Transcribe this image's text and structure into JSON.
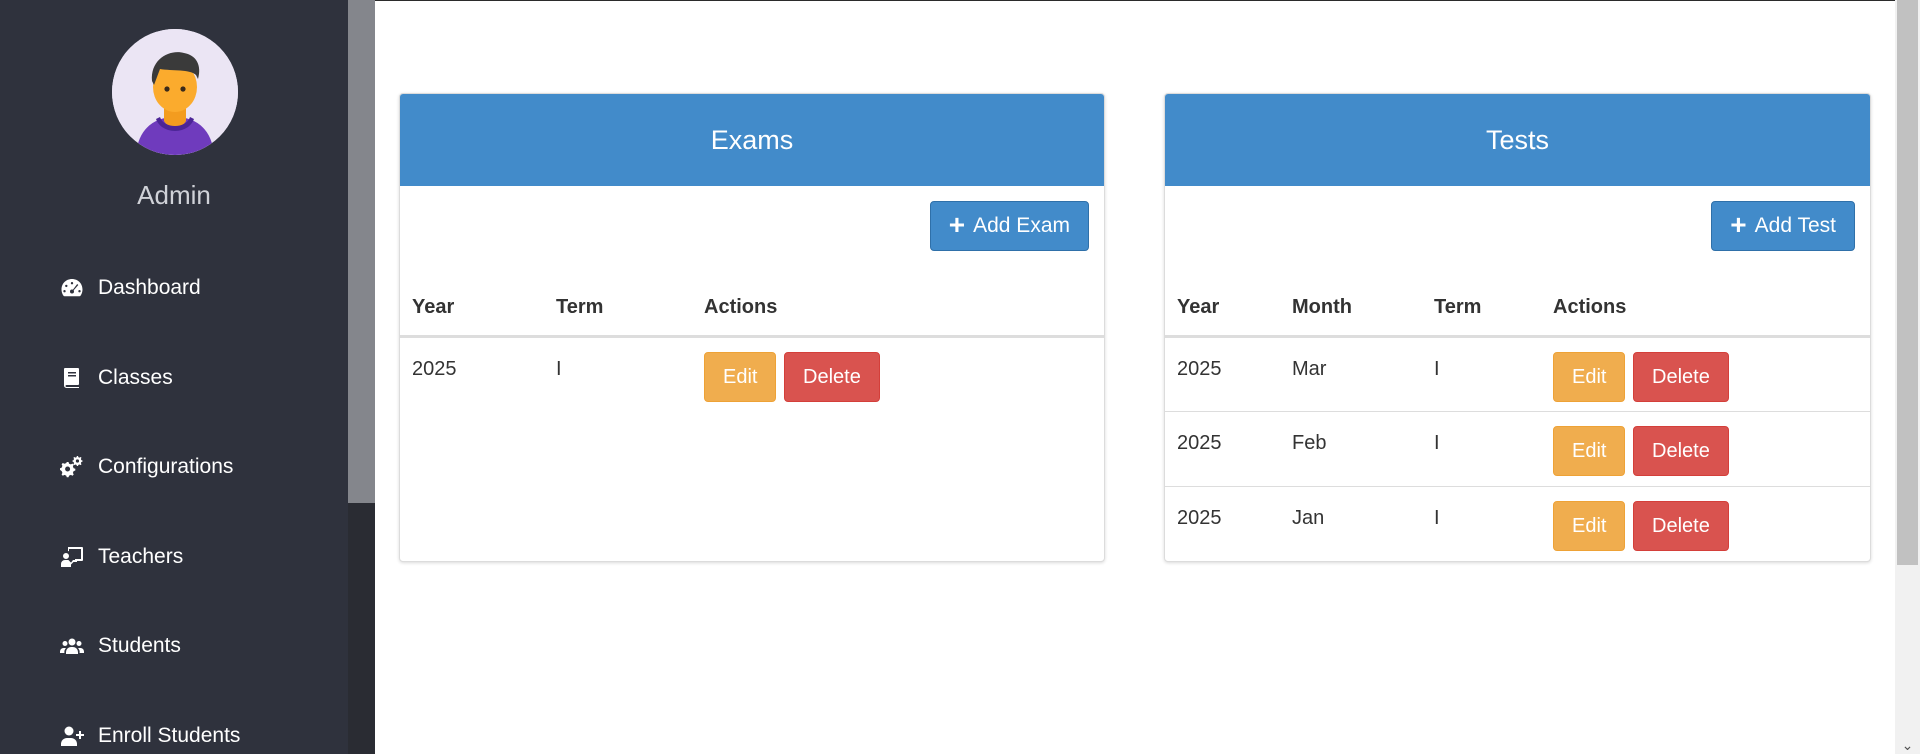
{
  "sidebar": {
    "user_name": "Admin",
    "avatar_icon": "user-avatar-icon",
    "items": [
      {
        "label": "Dashboard",
        "icon": "speedometer-icon"
      },
      {
        "label": "Classes",
        "icon": "book-icon"
      },
      {
        "label": "Configurations",
        "icon": "gears-icon"
      },
      {
        "label": "Teachers",
        "icon": "chalkboard-teacher-icon"
      },
      {
        "label": "Students",
        "icon": "users-icon"
      },
      {
        "label": "Enroll Students",
        "icon": "user-plus-icon"
      }
    ]
  },
  "exams": {
    "title": "Exams",
    "add_label": "Add Exam",
    "columns": [
      "Year",
      "Term",
      "Actions"
    ],
    "rows": [
      {
        "year": "2025",
        "term": "I"
      }
    ],
    "edit_label": "Edit",
    "delete_label": "Delete"
  },
  "tests": {
    "title": "Tests",
    "add_label": "Add Test",
    "columns": [
      "Year",
      "Month",
      "Term",
      "Actions"
    ],
    "rows": [
      {
        "year": "2025",
        "month": "Mar",
        "term": "I"
      },
      {
        "year": "2025",
        "month": "Feb",
        "term": "I"
      },
      {
        "year": "2025",
        "month": "Jan",
        "term": "I"
      }
    ],
    "edit_label": "Edit",
    "delete_label": "Delete"
  },
  "colors": {
    "sidebar_bg": "#2f323d",
    "primary": "#428bca",
    "warning": "#f0ad4e",
    "danger": "#d9534f"
  }
}
